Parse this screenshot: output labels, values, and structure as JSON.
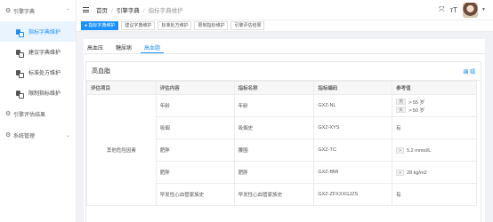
{
  "sidebar": {
    "groups": [
      {
        "icon": "settings-icon",
        "label": "引擎字典",
        "expanded": true
      },
      {
        "icon": "settings-icon",
        "label": "引擎评估结果"
      },
      {
        "icon": "settings-icon",
        "label": "系统管理",
        "expanded": false
      }
    ],
    "items": [
      {
        "label": "指标字典维护",
        "active": true
      },
      {
        "label": "建议字典维护"
      },
      {
        "label": "标准处方维护"
      },
      {
        "label": "限制指标维护"
      }
    ]
  },
  "breadcrumb": {
    "home": "首页",
    "section": "引擎字典",
    "current": "指标字典维护"
  },
  "tags": [
    {
      "label": "● 指标字典维护",
      "active": true
    },
    {
      "label": "建议字典维护"
    },
    {
      "label": "标准处方维护"
    },
    {
      "label": "限制指标维护"
    },
    {
      "label": "引擎评估结果"
    }
  ],
  "subtabs": [
    {
      "label": "高血压"
    },
    {
      "label": "糖尿病"
    },
    {
      "label": "高血脂",
      "active": true
    }
  ],
  "panel": {
    "title": "高血脂",
    "edit_label": "编 辑",
    "headers": [
      "评估项目",
      "评估内容",
      "指标名称",
      "指标编码",
      "参考值"
    ],
    "group_label": "其他危险因素",
    "rows": [
      {
        "content": "年龄",
        "name": "年龄",
        "code": "GXZ-NL",
        "ref": [
          {
            "badge": "男",
            "value": "> 55 岁"
          },
          {
            "badge": "女",
            "value": "> 50 岁"
          }
        ]
      },
      {
        "content": "吸烟",
        "name": "吸烟史",
        "code": "GXZ-XYS",
        "ref": [
          {
            "badge": "",
            "value": "有"
          }
        ]
      },
      {
        "content": "肥胖",
        "name": "腰围",
        "code": "GXZ-TC",
        "ref": [
          {
            "badge": ">",
            "value": "5.2 mmol/L"
          }
        ]
      },
      {
        "content": "肥胖",
        "name": "肥胖",
        "code": "GXZ-BMI",
        "ref": [
          {
            "badge": ">",
            "value": "28 kg/m2"
          }
        ]
      },
      {
        "content": "早发性心血管家族史",
        "name": "早发性心血管家族史",
        "code": "GXZ-ZFXXXGJZS",
        "ref": [
          {
            "badge": "",
            "value": "有"
          }
        ]
      }
    ]
  },
  "topbar": {
    "icons": [
      "fullscreen-icon",
      "font-size-icon"
    ]
  },
  "colors": {
    "accent": "#1890ff",
    "sidebar_active_bg": "#eaf4ff"
  }
}
